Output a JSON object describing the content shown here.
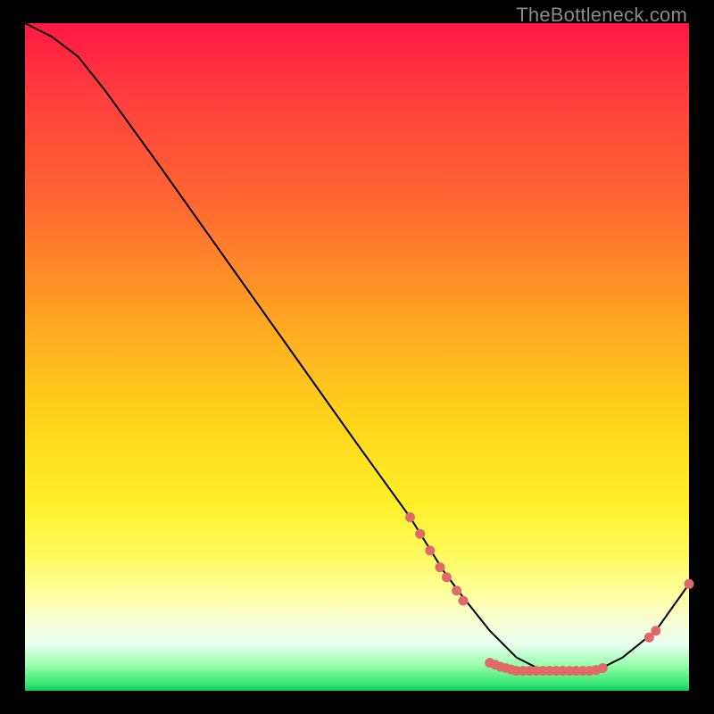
{
  "watermark": "TheBottleneck.com",
  "chart_data": {
    "type": "line",
    "title": "",
    "xlabel": "",
    "ylabel": "",
    "xlim": [
      0,
      100
    ],
    "ylim": [
      0,
      100
    ],
    "grid": false,
    "legend": false,
    "series": [
      {
        "name": "curve",
        "x": [
          0,
          4,
          8,
          12,
          20,
          30,
          40,
          50,
          58,
          63,
          66,
          70,
          74,
          78,
          82,
          86,
          90,
          95,
          100
        ],
        "y": [
          100,
          98,
          95,
          90,
          79,
          65,
          51,
          37,
          26,
          18,
          14,
          9,
          5,
          3,
          3,
          3,
          5,
          9,
          16
        ]
      }
    ],
    "markers": [
      {
        "x": 58,
        "y": 26
      },
      {
        "x": 59.5,
        "y": 23.5
      },
      {
        "x": 61,
        "y": 21
      },
      {
        "x": 62.5,
        "y": 18.5
      },
      {
        "x": 63.5,
        "y": 17
      },
      {
        "x": 65,
        "y": 15
      },
      {
        "x": 66,
        "y": 13.5
      },
      {
        "x": 70,
        "y": 4.2
      },
      {
        "x": 70.8,
        "y": 3.9
      },
      {
        "x": 71.6,
        "y": 3.6
      },
      {
        "x": 72.4,
        "y": 3.4
      },
      {
        "x": 73.2,
        "y": 3.2
      },
      {
        "x": 74,
        "y": 3.0
      },
      {
        "x": 75,
        "y": 3.0
      },
      {
        "x": 76,
        "y": 3.0
      },
      {
        "x": 77,
        "y": 3.0
      },
      {
        "x": 78,
        "y": 3.0
      },
      {
        "x": 79,
        "y": 3.0
      },
      {
        "x": 80,
        "y": 3.0
      },
      {
        "x": 81,
        "y": 3.0
      },
      {
        "x": 82,
        "y": 3.0
      },
      {
        "x": 83,
        "y": 3.0
      },
      {
        "x": 84,
        "y": 3.0
      },
      {
        "x": 85,
        "y": 3.0
      },
      {
        "x": 86,
        "y": 3.1
      },
      {
        "x": 87,
        "y": 3.4
      },
      {
        "x": 94,
        "y": 8
      },
      {
        "x": 95,
        "y": 9
      },
      {
        "x": 100,
        "y": 16
      }
    ]
  }
}
